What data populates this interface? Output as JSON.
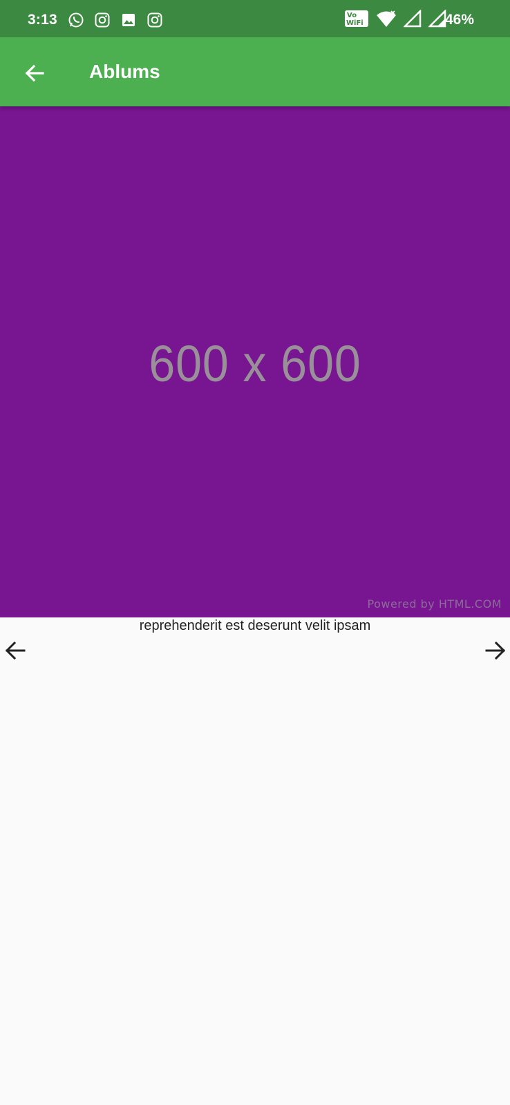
{
  "status_bar": {
    "time": "3:13",
    "battery": "46%",
    "wifi_badge_top": "Vo",
    "wifi_badge_bottom": "WiFi",
    "icons_left": [
      "whatsapp-icon",
      "instagram-icon",
      "gallery-icon",
      "instagram-icon"
    ],
    "icons_right": [
      "vowifi-icon",
      "wifi-icon",
      "signal-icon",
      "signal-icon"
    ]
  },
  "app_bar": {
    "title": "Ablums",
    "back_icon": "arrow-left-icon",
    "color": "#4caf50"
  },
  "photo": {
    "placeholder_text": "600 x 600",
    "watermark": "Powered by HTML.COM",
    "background": "#771690"
  },
  "caption": "reprehenderit est deserunt velit ipsam",
  "navigation": {
    "prev_icon": "arrow-left-icon",
    "next_icon": "arrow-right-icon"
  }
}
